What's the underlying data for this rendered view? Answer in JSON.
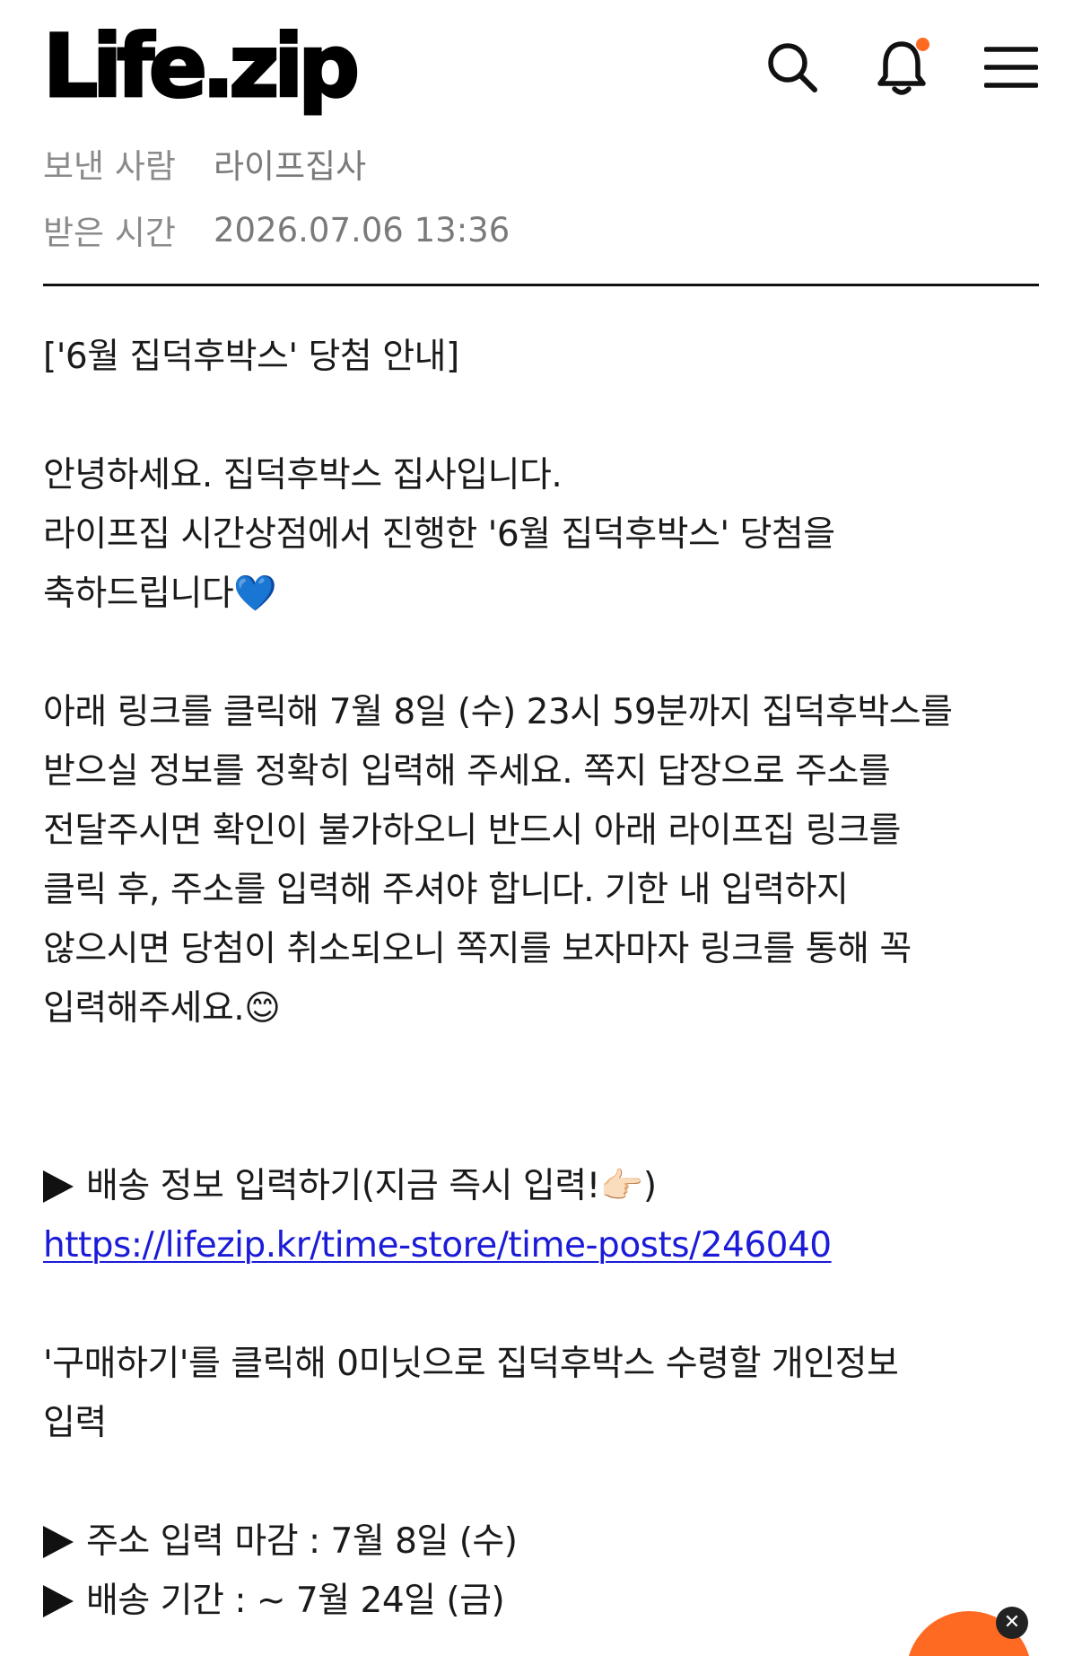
{
  "header": {
    "logo_text": "Life.zip",
    "icons": [
      "search-icon",
      "bell-icon",
      "menu-icon"
    ]
  },
  "meta": {
    "sender_label": "보낸 사람",
    "sender_value": "라이프집사",
    "received_label": "받은 시간",
    "received_value": "2026.07.06 13:36"
  },
  "message": {
    "title": "['6월 집덕후박스' 당첨 안내]",
    "para1_line1": "안녕하세요. 집덕후박스 집사입니다.",
    "para1_line2": "라이프집 시간상점에서 진행한 '6월 집덕후박스' 당첨을",
    "para1_line3": "축하드립니다💙",
    "para2_line1": "아래 링크를 클릭해 7월 8일 (수) 23시 59분까지 집덕후박스를",
    "para2_line2": "받으실 정보를 정확히 입력해 주세요. 쪽지 답장으로 주소를",
    "para2_line3": "전달주시면 확인이 불가하오니 반드시 아래 라이프집 링크를",
    "para2_line4": "클릭 후, 주소를 입력해 주셔야 합니다. 기한 내 입력하지",
    "para2_line5": "않으시면 당첨이 취소되오니 쪽지를 보자마자 링크를 통해 꼭",
    "para2_line6": "입력해주세요.😊",
    "shipping_info_label": "배송 정보 입력하기(지금 즉시 입력!👉🏻)",
    "link": "https://lifezip.kr/time-store/time-posts/246040",
    "instruction_line1": "'구매하기'를 클릭해 0미닛으로 집덕후박스 수령할 개인정보",
    "instruction_line2": "입력",
    "deadline": "주소 입력 마감 : 7월 8일 (수)",
    "delivery_period": "배송 기간 : ~ 7월 24일 (금)"
  },
  "colors": {
    "accent": "#ff6a22",
    "link": "#1b1bd8",
    "meta_text": "#8a8a8a"
  }
}
